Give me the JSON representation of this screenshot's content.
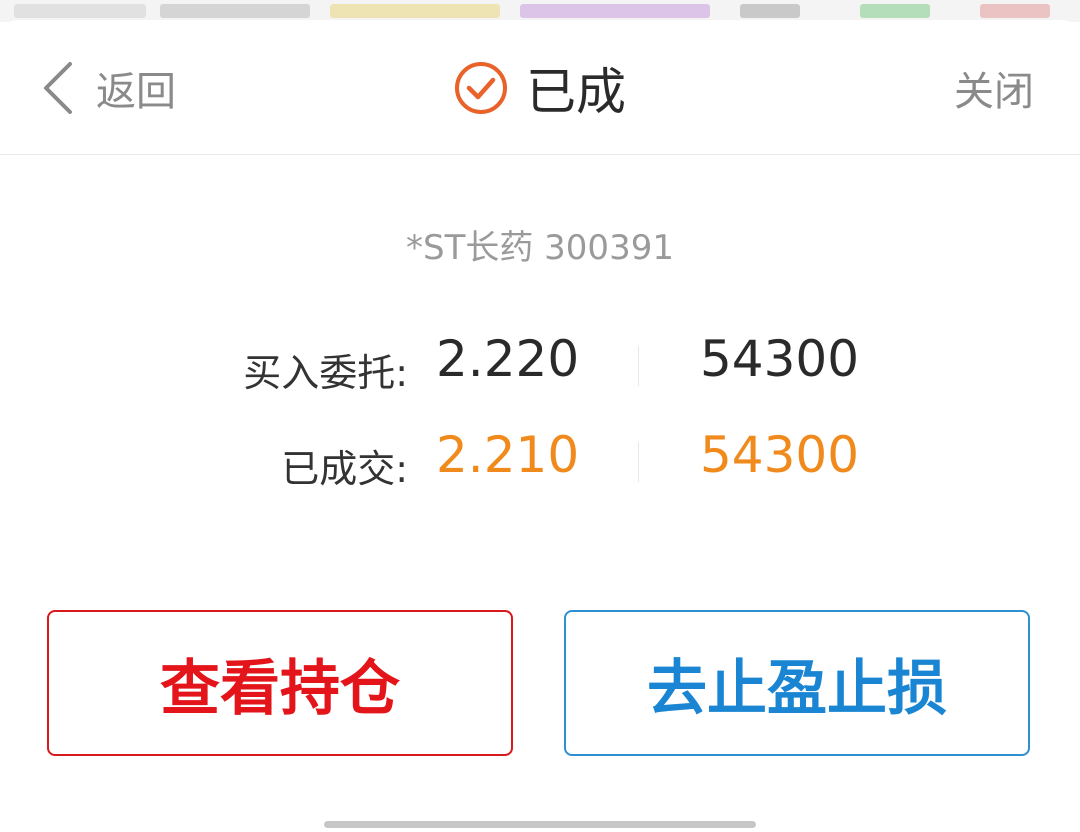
{
  "header": {
    "back_label": "返回",
    "title": "已成",
    "close_label": "关闭"
  },
  "icons": {
    "back": "chevron-left-icon",
    "status": "check-circle-icon"
  },
  "stock": {
    "label": "*ST长药 300391"
  },
  "order": {
    "label": "买入委托:",
    "price": "2.220",
    "quantity": "54300"
  },
  "fill": {
    "label": "已成交:",
    "price": "2.210",
    "quantity": "54300"
  },
  "actions": {
    "view_position": "查看持仓",
    "stop_profit_loss": "去止盈止损"
  },
  "colors": {
    "accent_orange": "#f08a1c",
    "status_icon": "#e8622a",
    "text_dark": "#2a2a2a",
    "text_gray": "#8a8a8a",
    "red": "#e3141a",
    "blue": "#1a86d3"
  }
}
